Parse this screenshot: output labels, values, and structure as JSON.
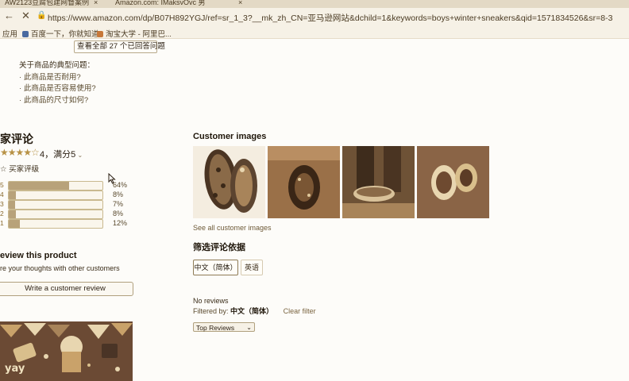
{
  "browser": {
    "tabs": [
      {
        "title": "AW2123豆腐包建网督案例"
      },
      {
        "title": "Amazon.com: IMaksvOvc 男"
      }
    ],
    "url": "https://www.amazon.com/dp/B07H892YGJ/ref=sr_1_3?__mk_zh_CN=亚马逊网站&dchild=1&keywords=boys+winter+sneakers&qid=1571834526&sr=8-3",
    "bookmarks": [
      {
        "label": "应用",
        "color": "#8a7a5a"
      },
      {
        "label": "百度一下，你就知道",
        "color": "#4a6aa0"
      },
      {
        "label": "淘宝大学 - 阿里巴...",
        "color": "#c7783a"
      }
    ]
  },
  "questions": {
    "see_all": "查看全部 27 个已回答问题",
    "title": "关于商品的典型问题：",
    "items": [
      "此商品是否耐用?",
      "此商品是否容易使用?",
      "此商品的尺寸如何?"
    ]
  },
  "reviews": {
    "heading": "家评论",
    "stars": "★★★★☆",
    "rating_text": "4，满分5",
    "global_count": "买家评级",
    "histogram": [
      {
        "star": "5",
        "percent": 64,
        "label": "64%"
      },
      {
        "star": "4",
        "percent": 8,
        "label": "8%"
      },
      {
        "star": "3",
        "percent": 7,
        "label": "7%"
      },
      {
        "star": "2",
        "percent": 8,
        "label": "8%"
      },
      {
        "star": "1",
        "percent": 12,
        "label": "12%"
      }
    ],
    "review_this": "eview this product",
    "share_text": "re your thoughts with other customers",
    "write_button": "Write a customer review"
  },
  "customer_images": {
    "heading": "Customer images",
    "see_all": "See all customer images"
  },
  "filter": {
    "heading": "筛选评论依据",
    "buttons": [
      "中文（简体）",
      "英语"
    ],
    "no_reviews": "No reviews",
    "filtered_by_label": "Filtered by:",
    "filtered_by_value": "中文（简体）",
    "clear_filter": "Clear filter",
    "sort": "Top Reviews"
  },
  "banner": {
    "text": "yay"
  }
}
